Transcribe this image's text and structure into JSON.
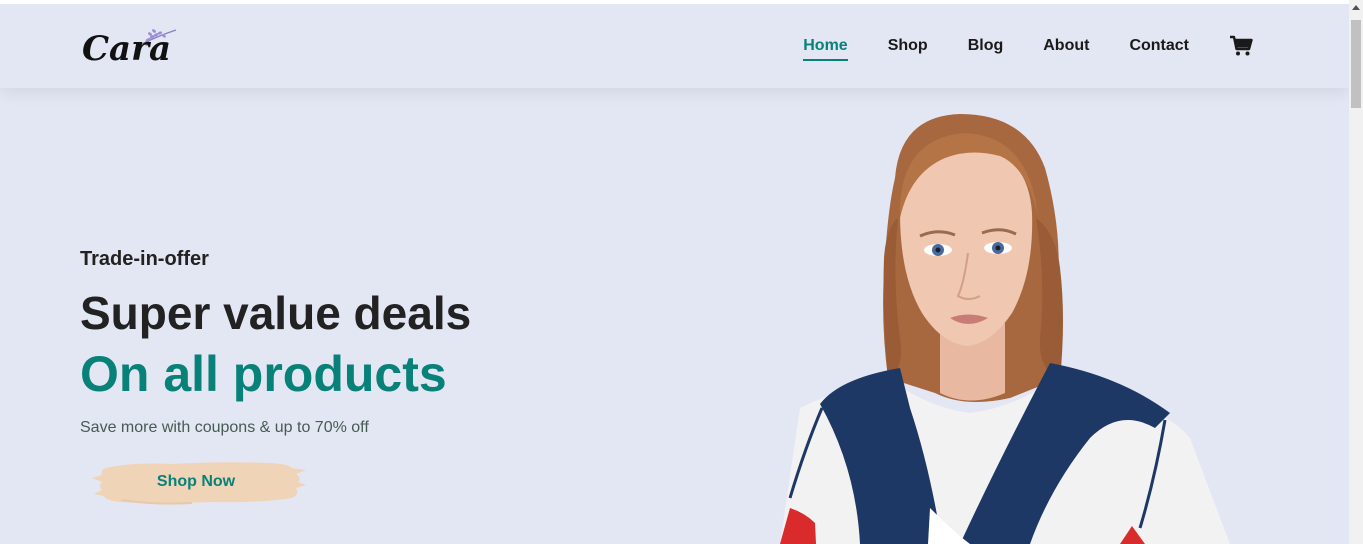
{
  "brand": {
    "logo_text": "Cara"
  },
  "nav": {
    "items": [
      {
        "label": "Home",
        "active": true
      },
      {
        "label": "Shop",
        "active": false
      },
      {
        "label": "Blog",
        "active": false
      },
      {
        "label": "About",
        "active": false
      },
      {
        "label": "Contact",
        "active": false
      }
    ],
    "cart_icon": "cart-icon"
  },
  "hero": {
    "kicker": "Trade-in-offer",
    "headline": "Super value deals",
    "highlight": "On all products",
    "subtext": "Save more with coupons & up to 70% off",
    "cta_label": "Shop Now"
  },
  "colors": {
    "accent": "#088178",
    "background": "#e3e6f3",
    "button_brush": "#f0d4b8",
    "text_dark": "#222222"
  }
}
